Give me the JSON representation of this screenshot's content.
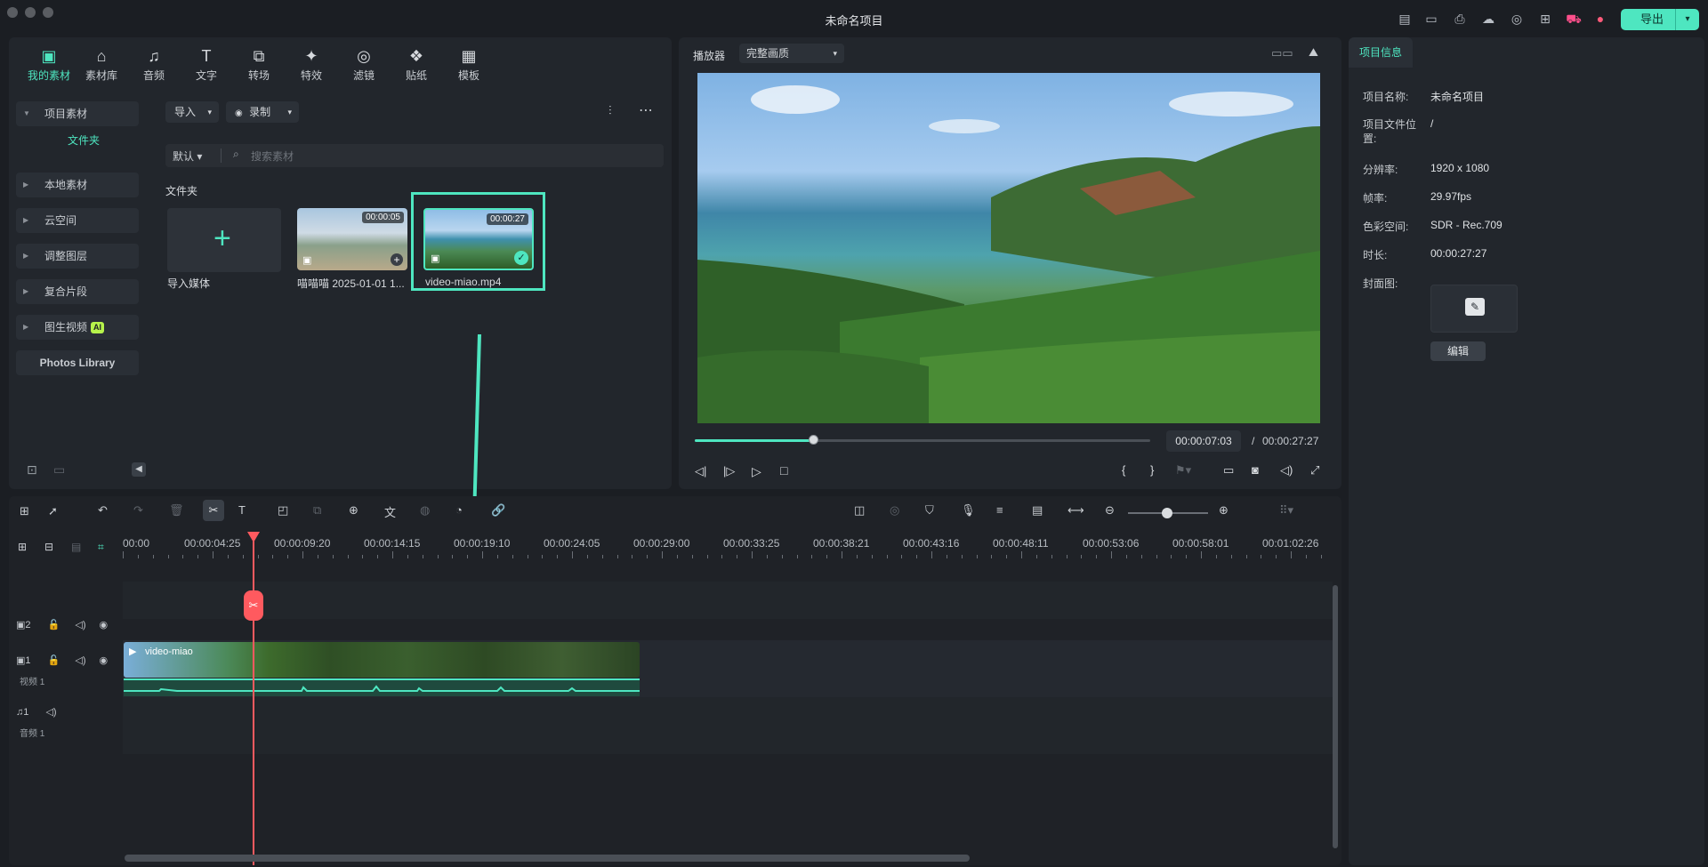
{
  "window": {
    "title": "未命名项目"
  },
  "header": {
    "export_label": "导出"
  },
  "media": {
    "tabs": [
      {
        "label": "我的素材",
        "icon": "my-media-icon"
      },
      {
        "label": "素材库",
        "icon": "library-icon"
      },
      {
        "label": "音频",
        "icon": "audio-icon"
      },
      {
        "label": "文字",
        "icon": "text-icon"
      },
      {
        "label": "转场",
        "icon": "transition-icon"
      },
      {
        "label": "特效",
        "icon": "effects-icon"
      },
      {
        "label": "滤镜",
        "icon": "filter-icon"
      },
      {
        "label": "贴纸",
        "icon": "sticker-icon"
      },
      {
        "label": "模板",
        "icon": "template-icon"
      }
    ],
    "sidebar": {
      "project_media": "项目素材",
      "folder": "文件夹",
      "local_media": "本地素材",
      "cloud": "云空间",
      "adjust_layer": "调整图层",
      "compound_clip": "复合片段",
      "img2video": "图生视频",
      "ai_badge": "AI",
      "photos": "Photos Library"
    },
    "import_label": "导入",
    "record_label": "录制",
    "sort_label": "默认",
    "search_placeholder": "搜索素材",
    "folder_heading": "文件夹",
    "import_media_label": "导入媒体",
    "items": [
      {
        "name": "喵喵喵 2025-01-01 1...",
        "duration": "00:00:05"
      },
      {
        "name": "video-miao.mp4",
        "duration": "00:00:27"
      }
    ]
  },
  "player": {
    "label": "播放器",
    "quality": "完整画质",
    "current_time": "00:00:07:03",
    "separator": "/",
    "total_time": "00:00:27:27",
    "progress": 0.26
  },
  "timeline": {
    "ticks": [
      "00:00",
      "00:00:04:25",
      "00:00:09:20",
      "00:00:14:15",
      "00:00:19:10",
      "00:00:24:05",
      "00:00:29:00",
      "00:00:33:25",
      "00:00:38:21",
      "00:00:43:16",
      "00:00:48:11",
      "00:00:53:06",
      "00:00:58:01",
      "00:01:02:26"
    ],
    "track2_num": "2",
    "track1_num": "1",
    "track1_name": "视频 1",
    "audio1_num": "1",
    "audio1_name": "音频 1",
    "clip_label": "video-miao"
  },
  "info": {
    "tab": "项目信息",
    "name_k": "项目名称:",
    "name_v": "未命名项目",
    "path_k": "项目文件位置:",
    "path_v": "/",
    "res_k": "分辨率:",
    "res_v": "1920 x 1080",
    "fps_k": "帧率:",
    "fps_v": "29.97fps",
    "color_k": "色彩空间:",
    "color_v": "SDR - Rec.709",
    "dur_k": "时长:",
    "dur_v": "00:00:27:27",
    "cover_k": "封面图:",
    "edit_label": "编辑"
  },
  "colors": {
    "accent": "#4ee6c0",
    "playhead": "#ff5a5f"
  }
}
